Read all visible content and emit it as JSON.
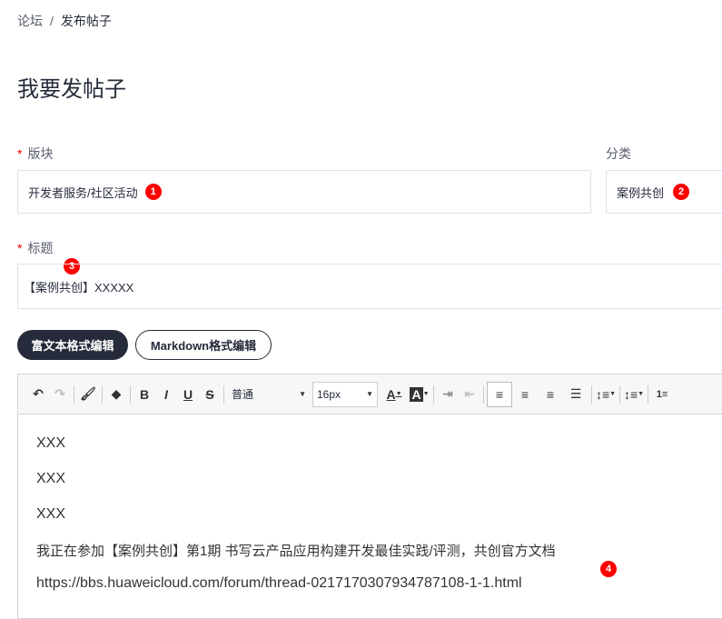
{
  "breadcrumb": {
    "items": [
      "论坛",
      "发布帖子"
    ],
    "separator": "/"
  },
  "page_title": "我要发帖子",
  "form": {
    "section": {
      "label": "版块",
      "required": "*",
      "value": "开发者服务/社区活动",
      "marker": "1"
    },
    "category": {
      "label": "分类",
      "value": "案例共创",
      "marker": "2"
    },
    "title": {
      "label": "标题",
      "required": "*",
      "value": "【案例共创】XXXXX",
      "marker": "3"
    }
  },
  "mode_buttons": {
    "rich": "富文本格式编辑",
    "markdown": "Markdown格式编辑"
  },
  "toolbar": {
    "paragraph_format": "普通",
    "font_size": "16px",
    "icons": [
      "undo",
      "redo",
      "format-painter",
      "eraser",
      "bold",
      "italic",
      "underline",
      "strikethrough",
      "font-color",
      "background-color",
      "indent",
      "outdent",
      "align-left",
      "align-center",
      "align-right",
      "justify",
      "line-height",
      "paragraph-spacing",
      "ordered-list"
    ],
    "bold": "B",
    "italic": "I",
    "underline": "U",
    "strike": "S",
    "font_color": "A",
    "bg_color": "A"
  },
  "content": {
    "lines": [
      "XXX",
      "XXX",
      "XXX",
      "我正在参加【案例共创】第1期 书写云产品应用构建开发最佳实践/评测，共创官方文档",
      "https://bbs.huaweicloud.com/forum/thread-0217170307934787108-1-1.html"
    ],
    "marker": "4"
  },
  "colors": {
    "primary_button": "#252b3a",
    "marker": "#ff0000",
    "required": "#ee0000"
  }
}
